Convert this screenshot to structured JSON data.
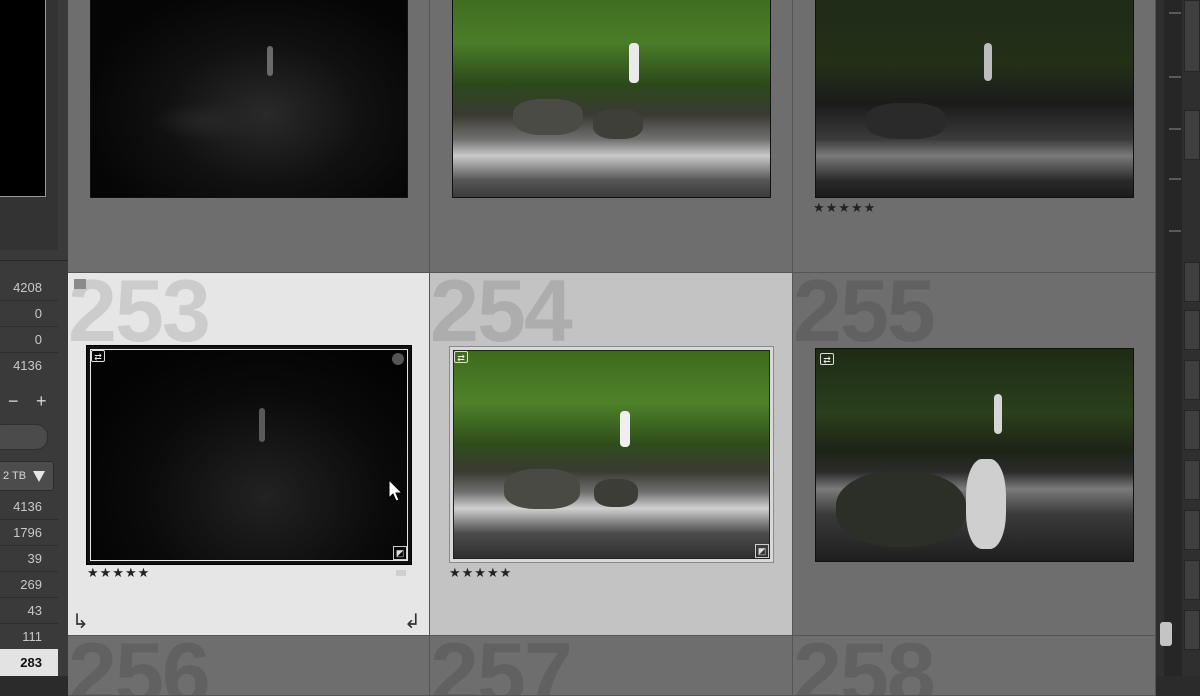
{
  "left_panel": {
    "stats_top": [
      "4208",
      "0",
      "0",
      "4136"
    ],
    "controls": {
      "minus": "−",
      "plus": "+"
    },
    "drive_label": "2 TB",
    "stats_bottom": [
      "4136",
      "1796",
      "39",
      "269",
      "43",
      "111",
      "283"
    ]
  },
  "grid": {
    "cells": [
      {
        "number": "",
        "rating": "",
        "flag": false
      },
      {
        "number": "",
        "rating": "",
        "flag": false
      },
      {
        "number": "",
        "rating": "★★★★★",
        "flag": false
      },
      {
        "number": "253",
        "rating": "★★★★★",
        "flag": true
      },
      {
        "number": "254",
        "rating": "★★★★★",
        "flag": false
      },
      {
        "number": "255",
        "rating": "",
        "flag": false
      },
      {
        "number": "256",
        "rating": "",
        "flag": false
      },
      {
        "number": "257",
        "rating": "",
        "flag": false
      },
      {
        "number": "258",
        "rating": "",
        "flag": false
      }
    ],
    "icons": {
      "virtual_copy": "⇄",
      "edited": "◩",
      "rotate_left": "↳",
      "rotate_right": "↲"
    }
  },
  "colors": {
    "grid_bg": "#6e6e6e",
    "selected_cell": "#e6e6e6",
    "hover_cell": "#c3c3c3",
    "panel_bg": "#3a3a3a"
  }
}
